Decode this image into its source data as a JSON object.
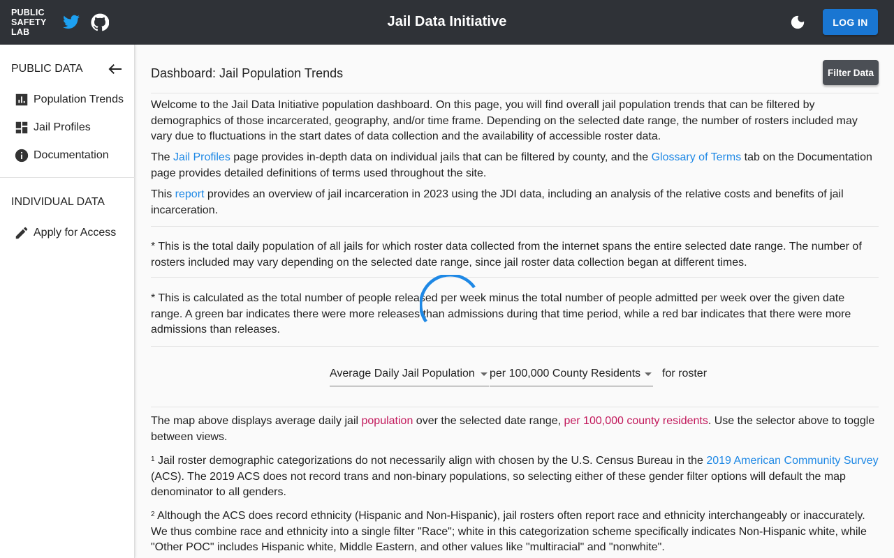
{
  "header": {
    "logo_lines": [
      "PUBLIC",
      "SAFETY",
      "LAB"
    ],
    "title": "Jail Data Initiative",
    "login_label": "LOG IN",
    "icons": {
      "twitter": "twitter-icon",
      "github": "github-icon",
      "theme": "moon-icon"
    },
    "colors": {
      "bar": "#2f3237",
      "login": "#1976d2"
    }
  },
  "sidebar": {
    "public_heading": "PUBLIC DATA",
    "individual_heading": "INDIVIDUAL DATA",
    "items": [
      {
        "label": "Population Trends",
        "icon": "bar-chart-icon"
      },
      {
        "label": "Jail Profiles",
        "icon": "dashboard-icon"
      },
      {
        "label": "Documentation",
        "icon": "info-icon"
      },
      {
        "label": "Apply for Access",
        "icon": "pencil-icon"
      }
    ]
  },
  "main": {
    "title": "Dashboard: Jail Population Trends",
    "filter_label": "Filter Data",
    "intro": "Welcome to the Jail Data Initiative population dashboard. On this page, you will find overall jail population trends that can be filtered by demographics of those incarcerated, geography, and/or time frame. Depending on the selected date range, the number of rosters included may vary due to fluctuations in the start dates of data collection and the availability of accessible roster data.",
    "profiles_p": {
      "pre": "The ",
      "link1": "Jail Profiles",
      "mid": " page provides in-depth data on individual jails that can be filtered by county, and the ",
      "link2": "Glossary of Terms",
      "post": " tab on the Documentation page provides detailed definitions of terms used throughout the site."
    },
    "report_p": {
      "pre": "This ",
      "link": "report",
      "post": " provides an overview of jail incarceration in 2023 using the JDI data, including an analysis of the relative costs and benefits of jail incarceration."
    },
    "note1": "* This is the total daily population of all jails for which roster data collected from the internet spans the entire selected date range. The number of rosters included may vary depending on the selected date range, since jail roster data collection began at different times.",
    "note2": "* This is calculated as the total number of people released per week minus the total number of people admitted per week over the given date range. A green bar indicates there were more releases than admissions during that time period, while a red bar indicates that there were more admissions than releases.",
    "selectors": {
      "metric": "Average Daily Jail Population",
      "denominator": "per 100,000 County Residents",
      "suffix": "for roster"
    },
    "map_p": {
      "pre": "The map above displays average daily jail ",
      "hl1": "population",
      "mid": " over the selected date range, ",
      "hl2": "per 100,000 county residents",
      "post": ". Use the selector above to toggle between views."
    },
    "fn1": {
      "num": "1",
      "pre": " Jail roster demographic categorizations do not necessarily align with chosen by the U.S. Census Bureau in the ",
      "link": "2019 American Community Survey",
      "post": " (ACS). The 2019 ACS does not record trans and non-binary populations, so selecting either of these gender filter options will default the map denominator to all genders."
    },
    "fn2": {
      "num": "2",
      "text": " Although the ACS does record ethnicity (Hispanic and Non-Hispanic), jail rosters often report race and ethnicity interchangeably or inaccurately. We thus combine race and ethnicity into a single filter \"Race\"; white in this categorization scheme specifically indicates Non-Hispanic white, while \"Other POC\" includes Hispanic white, Middle Eastern, and other values like \"multiracial\" and \"nonwhite\"."
    },
    "colors": {
      "link": "#1e88e5",
      "highlight": "#c2185b",
      "spinner": "#1e88e5"
    }
  }
}
